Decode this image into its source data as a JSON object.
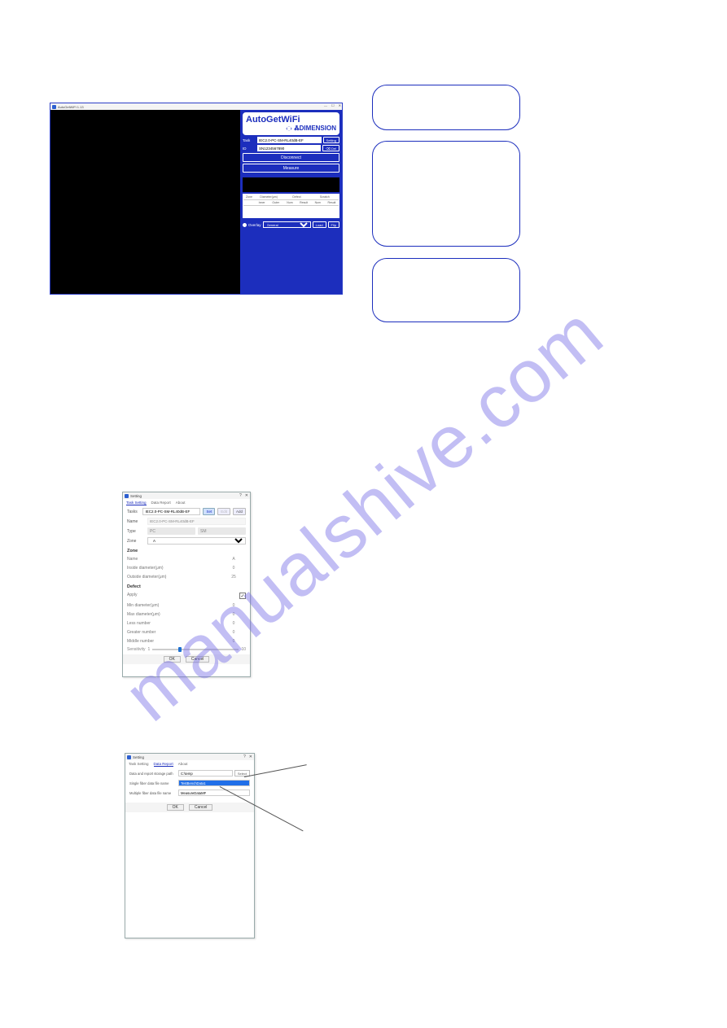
{
  "watermark": "manualshive.com",
  "app": {
    "title": "AutoGetWiFi 1.13",
    "min": "—",
    "max": "☐",
    "close": "✕",
    "brand_title": "AutoGetWiFi",
    "brand_sub": "ᏜDIMENSION",
    "task_label": "Task",
    "task_value": "IEC2.0-PC-SM-RL40dB-EF",
    "setting_btn": "Setting",
    "id_label": "ID",
    "id_value": "SN1234567890",
    "del_btn": "⌫ Del",
    "disconnect_btn": "Disconnect",
    "measure_btn": "Measure",
    "table": {
      "corner": "Zone",
      "group1": "Diameter(μm)",
      "group2": "Defect",
      "group3": "Scratch",
      "cols": [
        "Inner",
        "Outer",
        "Num",
        "Result",
        "Num",
        "Result"
      ]
    },
    "overlay_label": "Overlay",
    "overlay_value": "General",
    "load_btn": "Load",
    "flip_btn": "Flip"
  },
  "dlg1": {
    "title": "Setting",
    "pin": "?",
    "close": "✕",
    "tabs": [
      "Task Setting",
      "Data Report",
      "About"
    ],
    "tasks_label": "Tasks",
    "tasks_value": "IEC2.0-PC-SM-RL40dB-EF",
    "set_btn": "Set",
    "edit_btn": "Edit",
    "add_btn": "Add",
    "name_label": "Name",
    "name_value": "IEC2.0-PC-SM-RL40dB-EF",
    "type_label": "Type",
    "type_pc": "PC",
    "type_sm": "SM",
    "zone_label": "Zone",
    "zone_value": "A",
    "section_zone": "Zone",
    "f_name_l": "Name",
    "f_name_v": "A",
    "f_inside_l": "Inside diameter(μm)",
    "f_inside_v": "0",
    "f_outside_l": "Outside diameter(μm)",
    "f_outside_v": "25",
    "section_defect": "Defect",
    "f_apply_l": "Apply",
    "check": "✓",
    "f_min_l": "Min diameter(μm)",
    "f_min_v": "0",
    "f_max_l": "Max diameter(μm)",
    "f_max_v": "0",
    "f_less_l": "Less number",
    "f_less_v": "0",
    "f_greater_l": "Greater number",
    "f_greater_v": "0",
    "f_middle_l": "Middle number",
    "f_middle_v": "0",
    "f_sens_l": "Sensitivity",
    "f_sens_min": "1",
    "f_sens_max": "10",
    "ok_btn": "OK",
    "cancel_btn": "Cancel"
  },
  "dlg2": {
    "title": "Setting",
    "pin": "?",
    "close": "✕",
    "tabs": [
      "Task Setting",
      "Data Report",
      "About"
    ],
    "path_label": "Data and report storage path",
    "path_value": "C:\\temp",
    "select_btn": "Select",
    "single_label": "Single fiber data file name",
    "single_value": "TestBenchData1",
    "multi_label": "Multiple fiber data file name",
    "multi_value": "MeasureDataMF",
    "ok_btn": "OK",
    "cancel_btn": "Cancel"
  }
}
